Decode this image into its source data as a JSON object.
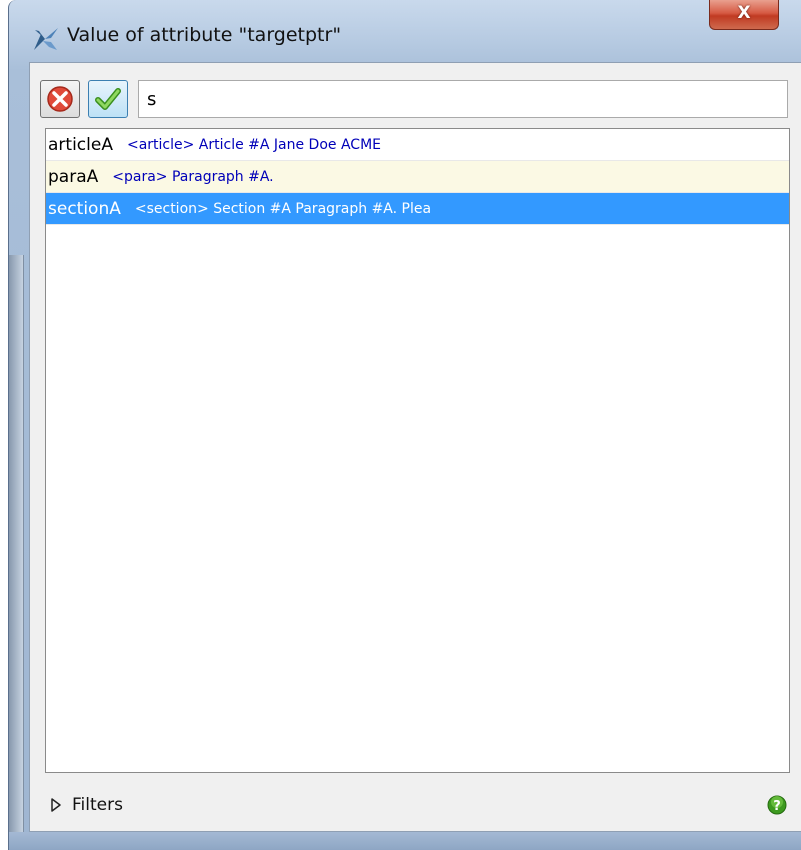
{
  "window": {
    "title": "Value of attribute \"targetptr\"",
    "close_label": "X"
  },
  "toolbar": {
    "search_value": "s"
  },
  "list": {
    "items": [
      {
        "id": "articleA",
        "desc": "<article> Article #A Jane Doe ACME",
        "selected": false
      },
      {
        "id": "paraA",
        "desc": "<para> Paragraph #A.",
        "selected": false
      },
      {
        "id": "sectionA",
        "desc": "<section> Section #A Paragraph #A. Plea",
        "selected": true
      }
    ]
  },
  "footer": {
    "filters_label": "Filters"
  },
  "colors": {
    "selection": "#3399ff",
    "item_desc": "#0000b8",
    "alt_row": "#fbf9e4"
  }
}
